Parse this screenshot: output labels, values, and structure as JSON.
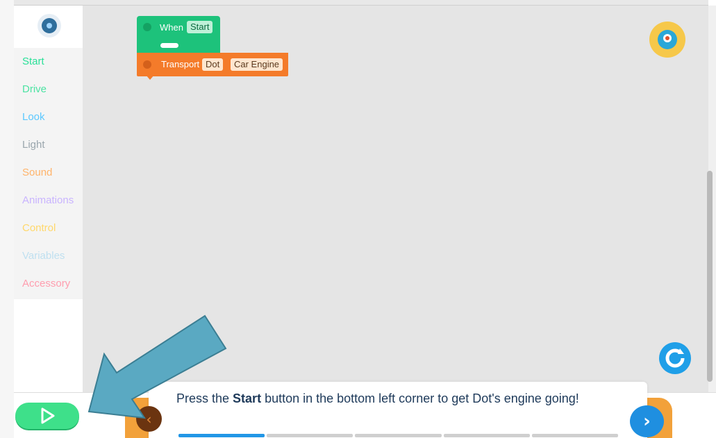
{
  "sidebar": {
    "logo_icon": "wonder-logo-icon",
    "categories": [
      {
        "label": "Start",
        "color": "#2ae098"
      },
      {
        "label": "Drive",
        "color": "#4de3a3"
      },
      {
        "label": "Look",
        "color": "#5bc8ff"
      },
      {
        "label": "Light",
        "color": "#9aa6ad"
      },
      {
        "label": "Sound",
        "color": "#ffb46b"
      },
      {
        "label": "Animations",
        "color": "#c9b4ff"
      },
      {
        "label": "Control",
        "color": "#ffd86b"
      },
      {
        "label": "Variables",
        "color": "#bfe0f0"
      },
      {
        "label": "Accessory",
        "color": "#ff9dae"
      }
    ]
  },
  "blocks": {
    "when": {
      "label": "When",
      "chip": "Start",
      "color": "#1dc27b"
    },
    "transport": {
      "label": "Transport",
      "chip_robot": "Dot",
      "chip_sound": "Car Engine",
      "color": "#f47b2a"
    }
  },
  "avatar": {
    "icon": "dot-robot-avatar-icon"
  },
  "reset_button": {
    "icon": "reset-icon"
  },
  "start_button": {
    "icon": "play-icon"
  },
  "tip": {
    "text_before": "Press the ",
    "text_bold": "Start",
    "text_after": " button in the bottom left corner to get Dot's engine going!",
    "prev_icon": "chevron-left-icon",
    "next_icon": "chevron-right-icon",
    "steps_total": 5,
    "steps_current": 1
  },
  "overlay": {
    "arrow_color": "#5aa9c2"
  }
}
